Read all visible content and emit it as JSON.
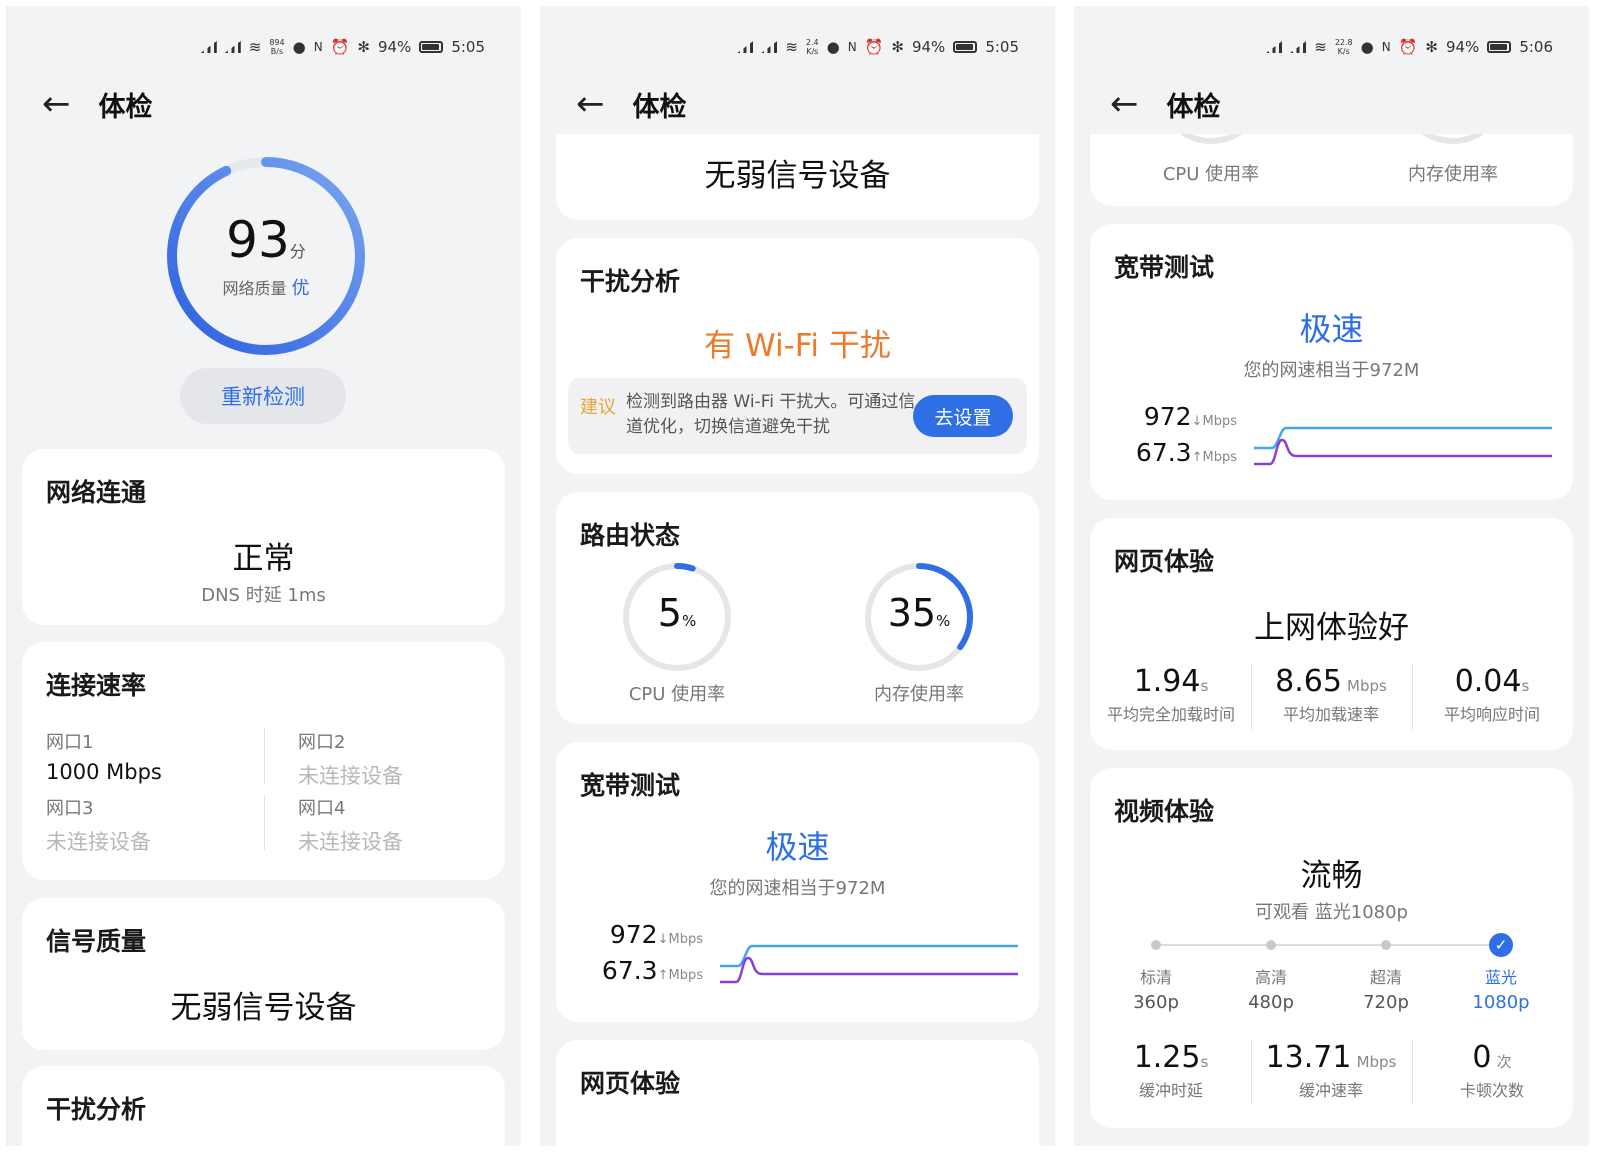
{
  "status": {
    "p1": {
      "speed_top": "894",
      "speed_unit": "B/s",
      "battery": "94%",
      "time": "5:05"
    },
    "p2": {
      "speed_top": "2.4",
      "speed_unit": "K/s",
      "battery": "94%",
      "time": "5:05"
    },
    "p3": {
      "speed_top": "22.8",
      "speed_unit": "K/s",
      "battery": "94%",
      "time": "5:06"
    }
  },
  "header": {
    "back_icon": "←",
    "title": "体检"
  },
  "score": {
    "value": "93",
    "unit": "分",
    "quality_label": "网络质量",
    "quality_value": "优",
    "score_fraction": 0.93,
    "recheck": "重新检测"
  },
  "network": {
    "label": "网络连通",
    "status": "正常",
    "dns": "DNS 时延 1ms"
  },
  "ports": {
    "label": "连接速率",
    "items": [
      {
        "name": "网口1",
        "value": "1000 Mbps"
      },
      {
        "name": "网口2",
        "value": "未连接设备"
      },
      {
        "name": "网口3",
        "value": "未连接设备"
      },
      {
        "name": "网口4",
        "value": "未连接设备"
      }
    ]
  },
  "signal": {
    "label": "信号质量",
    "value": "无弱信号设备"
  },
  "interference": {
    "label": "干扰分析",
    "value": "有 Wi-Fi 干扰",
    "advice_tag": "建议",
    "advice_text": "检测到路由器 Wi-Fi 干扰大。可通过信道优化，切换信道避免干扰",
    "advice_button": "去设置"
  },
  "router": {
    "label": "路由状态",
    "cpu": {
      "value": "5",
      "unit": "%",
      "label": "CPU 使用率",
      "fraction": 0.05
    },
    "mem": {
      "value": "35",
      "unit": "%",
      "label": "内存使用率",
      "fraction": 0.35
    }
  },
  "broadband": {
    "label": "宽带测试",
    "result": "极速",
    "desc": "您的网速相当于972M",
    "down": "972",
    "down_arrow": "↓",
    "down_unit": "Mbps",
    "up": "67.3",
    "up_arrow": "↑",
    "up_unit": "Mbps"
  },
  "web": {
    "label": "网页体验",
    "result": "上网体验好",
    "metrics": [
      {
        "value": "1.94",
        "unit": "s",
        "label": "平均完全加载时间"
      },
      {
        "value": "8.65",
        "unit": "Mbps",
        "label": "平均加载速率"
      },
      {
        "value": "0.04",
        "unit": "s",
        "label": "平均响应时间"
      }
    ]
  },
  "video": {
    "label": "视频体验",
    "result": "流畅",
    "desc": "可观看 蓝光1080p",
    "levels": [
      {
        "label": "标清",
        "res": "360p"
      },
      {
        "label": "高清",
        "res": "480p"
      },
      {
        "label": "超清",
        "res": "720p"
      },
      {
        "label": "蓝光",
        "res": "1080p"
      }
    ],
    "check_icon": "✓",
    "metrics": [
      {
        "value": "1.25",
        "unit": "s",
        "label": "缓冲时延"
      },
      {
        "value": "13.71",
        "unit": "Mbps",
        "label": "缓冲速率"
      },
      {
        "value": "0",
        "unit": "次",
        "label": "卡顿次数"
      }
    ]
  },
  "colors": {
    "accent": "#2f6fe6",
    "warning": "#ec7a2a",
    "upload_line": "#8a3fd8",
    "download_line": "#45a6e6"
  }
}
